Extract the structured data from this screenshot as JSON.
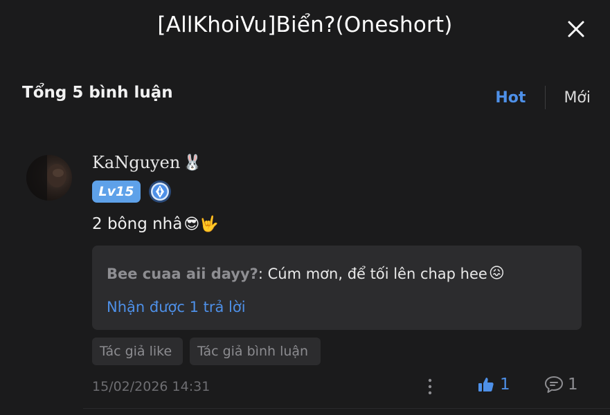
{
  "header": {
    "title": "[AllKhoiVu]Biển?(Oneshort)"
  },
  "comments_summary": {
    "count_label": "Tổng 5 bình luận",
    "sort_hot": "Hot",
    "sort_new": "Mới"
  },
  "comment": {
    "username": "KaNguyen",
    "username_emoji": "🐰",
    "level": "Lv15",
    "text": "2 bông nhâ",
    "text_emojis": "😎🤟",
    "reply": {
      "author": "Bee cuaa aii dayy?",
      "separator": ": ",
      "text": "Cúm mơn, để tối lên chap hee",
      "emoji": "😖",
      "more_label": "Nhận được 1 trả lời"
    },
    "tags": [
      "Tác giả like",
      "Tác giả bình luận"
    ],
    "timestamp": "15/02/2026 14:31",
    "like_count": "1",
    "reply_count": "1"
  },
  "colors": {
    "background": "#1b1b1c",
    "accent": "#4e90e8",
    "panel": "#2c2c2e",
    "level_badge": "#5ea1e9"
  },
  "icons": {
    "close": "close-icon",
    "author_badge": "pen-nib-badge-icon",
    "more": "vertical-dots-icon",
    "like": "thumbs-up-icon",
    "reply": "chat-bubble-icon"
  }
}
